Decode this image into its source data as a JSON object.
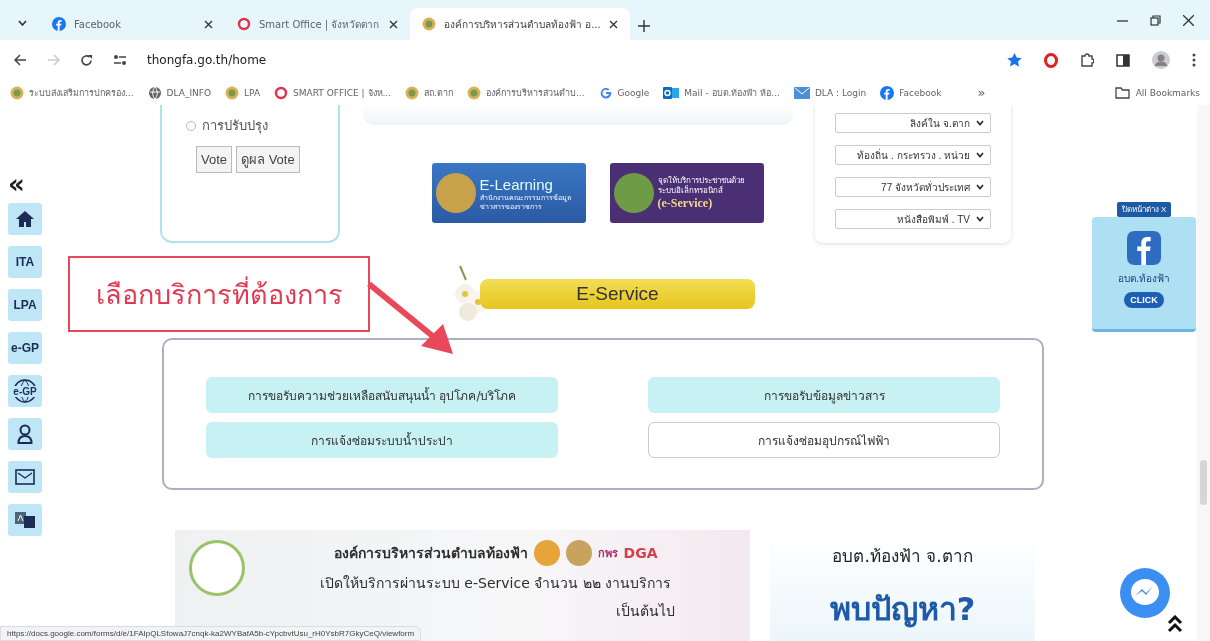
{
  "tabs": [
    {
      "title": "Facebook",
      "kind": "facebook",
      "selected": false
    },
    {
      "title": "Smart Office | จังหวัดตาก",
      "kind": "ring",
      "selected": false
    },
    {
      "title": "องค์การบริหารส่วนตำบลท้องฟ้า อ...",
      "kind": "seal",
      "selected": true
    }
  ],
  "address_bar": {
    "url": "thongfa.go.th/home"
  },
  "bookmarks": [
    {
      "label": "ระบบส่งเสริมการปกครอง...",
      "kind": "seal"
    },
    {
      "label": "DLA_INFO",
      "kind": "globe"
    },
    {
      "label": "LPA",
      "kind": "seal"
    },
    {
      "label": "SMART OFFICE | จังห...",
      "kind": "ring"
    },
    {
      "label": "สถ.ตาก",
      "kind": "seal"
    },
    {
      "label": "องค์การบริหารส่วนตำบ...",
      "kind": "seal"
    },
    {
      "label": "Google",
      "kind": "google"
    },
    {
      "label": "Mail - อบต.ท้องฟ้า ห้อ...",
      "kind": "outlook"
    },
    {
      "label": "DLA : Login",
      "kind": "mail"
    },
    {
      "label": "Facebook",
      "kind": "facebook"
    }
  ],
  "bookmarks_overflow": "»",
  "all_bookmarks": "All Bookmarks",
  "sidebar": {
    "collapse": "«",
    "items": [
      {
        "kind": "home"
      },
      {
        "kind": "text",
        "label": "ITA"
      },
      {
        "kind": "text",
        "label": "LPA"
      },
      {
        "kind": "text",
        "label": "e-GP"
      },
      {
        "kind": "globe",
        "label": "e-GP"
      },
      {
        "kind": "person"
      },
      {
        "kind": "mail"
      },
      {
        "kind": "translate"
      }
    ]
  },
  "poll": {
    "options": [
      {
        "label": "การปรับปรุง",
        "selected": false
      }
    ],
    "buttons": [
      "Vote",
      "ดูผล Vote"
    ]
  },
  "banners": [
    {
      "kind": "e-learning",
      "title": "E-Learning",
      "subtitle": "สำนักงานคณะกรรมการข้อมูลข่าวสารของราชการ"
    },
    {
      "kind": "e-service",
      "title": "จุดให้บริการประชาชนด้วยระบบอิเล็กทรอนิกส์",
      "subtitle": "(e-Service)"
    }
  ],
  "link_selects": [
    "ลิงค์ใน จ.ตาก",
    "ท้องถิ่น . กระทรวง . หน่วย",
    "77 จังหวัดทั่วประเทศ",
    "หนังสือพิมพ์ . TV"
  ],
  "facebook_widget": {
    "close": "ปิดหน้าต่าง X",
    "name": "อบต.ท้องฟ้า",
    "button": "CLICK"
  },
  "annotation": {
    "text": "เลือกบริการที่ต้องการ"
  },
  "section_title": "E-Service",
  "services": [
    {
      "label": "การขอรับความช่วยเหลือสนับสนุนน้ำ อุปโภค/บริโภค",
      "highlighted": true
    },
    {
      "label": "การขอรับข้อมูลข่าวสาร",
      "highlighted": true
    },
    {
      "label": "การแจ้งซ่อมระบบน้ำประปา",
      "highlighted": true
    },
    {
      "label": "การแจ้งซ่อมอุปกรณ์ไฟฟ้า",
      "highlighted": false
    }
  ],
  "promo": {
    "lines": [
      "องค์การบริหารส่วนตำบลท้องฟ้า",
      "เปิดให้บริการผ่านระบบ e-Service จำนวน ๒๒ งานบริการ",
      "เป็นต้นไป"
    ],
    "logos": [
      "กพร",
      "DGA"
    ]
  },
  "promo_side": {
    "title": "อบต.ท้องฟ้า จ.ตาก",
    "headline": "พบปัญหา?"
  },
  "status_url": "https://docs.google.com/forms/d/e/1FAIpQLSfowaJ7cnqk-ka2WYBafA5b-cYpcbvtUsu_rH0YsbR7GkyCeQ/viewform"
}
